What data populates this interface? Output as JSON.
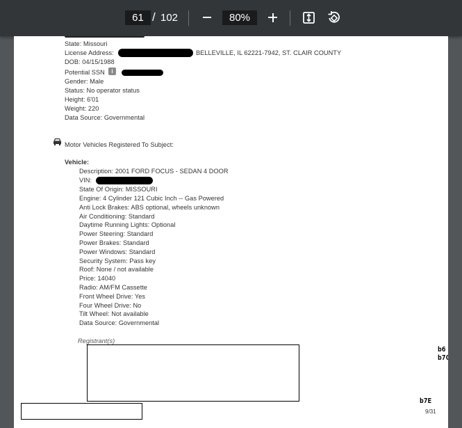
{
  "toolbar": {
    "current_page": "61",
    "separator": "/",
    "total_pages": "102",
    "zoom": "80%",
    "icons": [
      "minus-icon",
      "plus-icon",
      "fit-page-icon",
      "rotate-icon"
    ]
  },
  "document": {
    "state": "State: Missouri",
    "license_label": "License Address:",
    "license_address": "BELLEVILLE, IL 62221-7942, ST. CLAIR COUNTY",
    "dob": "DOB: 04/15/1988",
    "ssn_label": "Potential SSN",
    "gender": "Gender: Male",
    "status": "Status: No operator status",
    "height": "Height: 6'01",
    "weight": "Weight: 220",
    "data_source": "Data Source: Governmental",
    "vehicles_heading": "Motor Vehicles Registered To Subject:",
    "vehicle_label": "Vehicle:",
    "description": "Description: 2001 FORD FOCUS - SEDAN 4 DOOR",
    "vin_label": "VIN:",
    "vehicle_details": [
      "State Of Origin: MISSOURI",
      "Engine: 4 Cylinder 121 Cubic Inch -- Gas Powered",
      "Anti Lock Brakes: ABS optional, wheels unknown",
      "Air Conditioning: Standard",
      "Daytime Running Lights: Optional",
      "Power Steering: Standard",
      "Power Brakes: Standard",
      "Power Windows: Standard",
      "Security System: Pass key",
      "Roof: None / not available",
      "Price: 14040",
      "Radio: AM/FM Cassette",
      "Front Wheel Drive: Yes",
      "Four Wheel Drive: No",
      "Tilt Wheel: Not available",
      "Data Source: Governmental"
    ],
    "registrants_label": "Registrant(s)",
    "exemption_codes_1": [
      "b6",
      "b7C"
    ],
    "exemption_code_2": "b7E",
    "page_footer": "9/31"
  }
}
